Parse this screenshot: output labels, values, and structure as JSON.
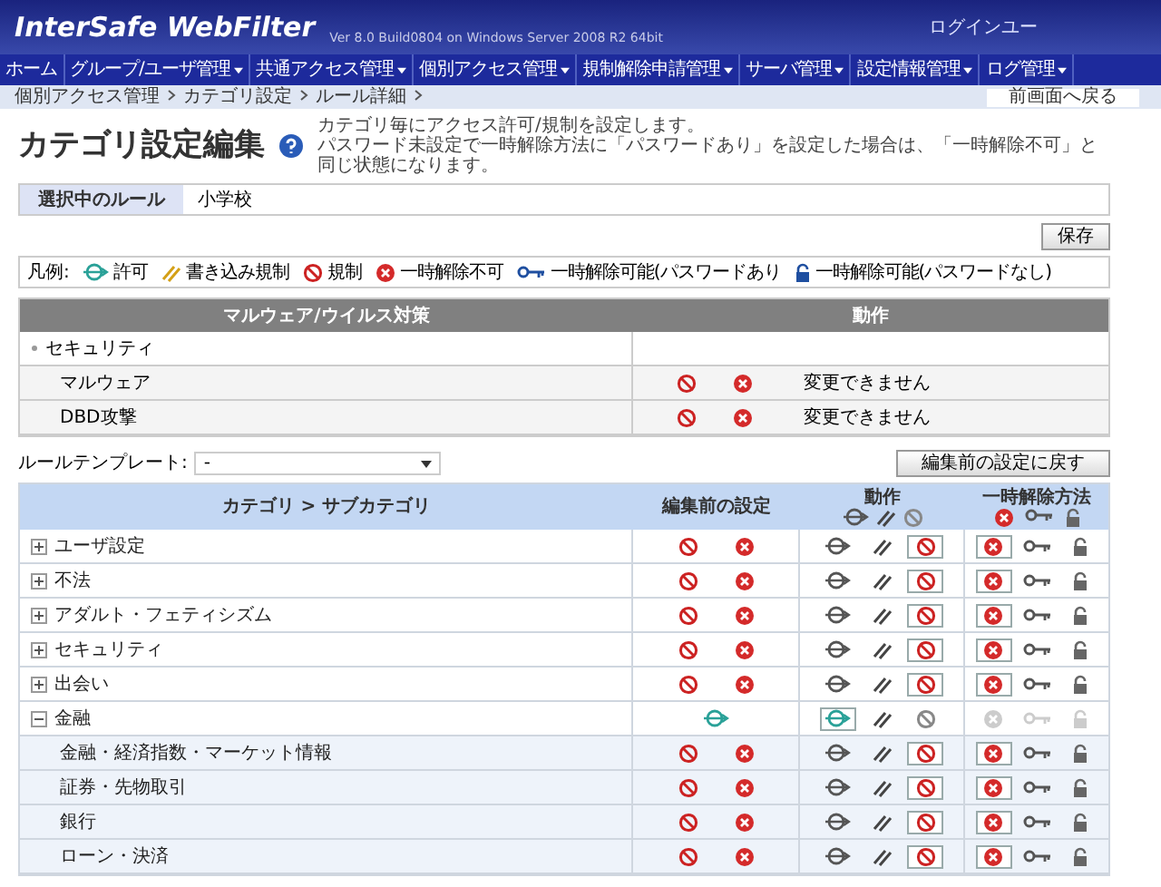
{
  "header": {
    "product": "InterSafe WebFilter",
    "version": "Ver 8.0 Build0804 on Windows Server 2008 R2 64bit",
    "login": "ログインユー"
  },
  "nav": [
    {
      "label": "ホーム",
      "dropdown": false
    },
    {
      "label": "グループ/ユーザ管理",
      "dropdown": true
    },
    {
      "label": "共通アクセス管理",
      "dropdown": true
    },
    {
      "label": "個別アクセス管理",
      "dropdown": true
    },
    {
      "label": "規制解除申請管理",
      "dropdown": true
    },
    {
      "label": "サーバ管理",
      "dropdown": true
    },
    {
      "label": "設定情報管理",
      "dropdown": true
    },
    {
      "label": "ログ管理",
      "dropdown": true
    }
  ],
  "breadcrumb": [
    "個別アクセス管理",
    "カテゴリ設定",
    "ルール詳細"
  ],
  "back_link": "前画面へ戻る",
  "title": "カテゴリ設定編集",
  "description": [
    "カテゴリ毎にアクセス許可/規制を設定します。",
    "パスワード未設定で一時解除方法に「パスワードあり」を設定した場合は、「一時解除不可」と同じ状態になります。"
  ],
  "rule": {
    "label": "選択中のルール",
    "value": "小学校"
  },
  "save_button": "保存",
  "legend": {
    "label": "凡例:",
    "items": [
      {
        "kind": "allow",
        "text": "許可"
      },
      {
        "kind": "write",
        "text": "書き込み規制"
      },
      {
        "kind": "block",
        "text": "規制"
      },
      {
        "kind": "nounlock",
        "text": "一時解除不可"
      },
      {
        "kind": "key",
        "text": "一時解除可能(パスワードあり"
      },
      {
        "kind": "lock",
        "text": "一時解除可能(パスワードなし)"
      }
    ]
  },
  "malware": {
    "columns": [
      "マルウェア/ウイルス対策",
      "動作"
    ],
    "group": "セキュリティ",
    "rows": [
      {
        "name": "マルウェア",
        "status": "変更できません"
      },
      {
        "name": "DBD攻撃",
        "status": "変更できません"
      }
    ]
  },
  "template": {
    "label": "ルールテンプレート:",
    "value": "-"
  },
  "revert_button": "編集前の設定に戻す",
  "table": {
    "columns": [
      "カテゴリ > サブカテゴリ",
      "編集前の設定",
      "動作",
      "一時解除方法"
    ],
    "rows": [
      {
        "name": "ユーザ設定",
        "expanded": false,
        "before_allowed": false,
        "allowed": false,
        "password_unlock": false,
        "unlock_disabled": false
      },
      {
        "name": "不法",
        "expanded": false,
        "before_allowed": false,
        "allowed": false,
        "password_unlock": false,
        "unlock_disabled": false
      },
      {
        "name": "アダルト・フェティシズム",
        "expanded": false,
        "before_allowed": false,
        "allowed": false,
        "password_unlock": false,
        "unlock_disabled": false
      },
      {
        "name": "セキュリティ",
        "expanded": false,
        "before_allowed": false,
        "allowed": false,
        "password_unlock": false,
        "unlock_disabled": false
      },
      {
        "name": "出会い",
        "expanded": false,
        "before_allowed": false,
        "allowed": false,
        "password_unlock": false,
        "unlock_disabled": false
      },
      {
        "name": "金融",
        "expanded": true,
        "before_allowed": true,
        "allowed": true,
        "unlock_disabled": true,
        "children": [
          {
            "name": "金融・経済指数・マーケット情報",
            "before_allowed": false,
            "allowed": false,
            "password_unlock": false,
            "unlock_disabled": false
          },
          {
            "name": "証券・先物取引",
            "before_allowed": false,
            "allowed": false,
            "password_unlock": false,
            "unlock_disabled": false
          },
          {
            "name": "銀行",
            "before_allowed": false,
            "allowed": false,
            "password_unlock": false,
            "unlock_disabled": false
          },
          {
            "name": "ローン・決済",
            "before_allowed": false,
            "allowed": false,
            "password_unlock": false,
            "unlock_disabled": false
          }
        ]
      }
    ]
  }
}
